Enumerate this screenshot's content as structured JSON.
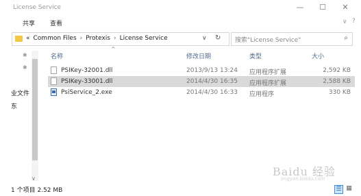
{
  "window": {
    "title": "License Service",
    "minimize": "—",
    "maximize": "☐",
    "close": "✕"
  },
  "ribbon": {
    "tabs": [
      "共享",
      "查看"
    ],
    "collapse_icon": "∨",
    "help_icon": "?"
  },
  "address": {
    "prefix": "«",
    "crumbs": [
      "Common Files",
      "Protexis",
      "License Service"
    ],
    "separator": "›",
    "dropdown": "∨",
    "refresh": "↻"
  },
  "search": {
    "placeholder": "搜索\"License Service\"",
    "icon": "⌕"
  },
  "nav": {
    "pins": [
      "✱",
      "✱"
    ],
    "items": [
      "业文件",
      "东"
    ],
    "arrow_down": "∨"
  },
  "columns": {
    "name": "名称",
    "modified": "修改日期",
    "type": "类型",
    "size": "大小",
    "sort_indicator": "^"
  },
  "files": [
    {
      "name": "PSIKey-32001.dll",
      "modified": "2013/9/13 13:24",
      "type": "应用程序扩展",
      "size": "2,592 KB",
      "selected": false,
      "kind": "dll"
    },
    {
      "name": "PSIKey-33001.dll",
      "modified": "2014/4/30 16:35",
      "type": "应用程序扩展",
      "size": "2,588 KB",
      "selected": true,
      "kind": "dll"
    },
    {
      "name": "PsiService_2.exe",
      "modified": "2014/4/30 16:33",
      "type": "应用程序",
      "size": "330 KB",
      "selected": false,
      "kind": "exe"
    }
  ],
  "status": {
    "text": "1 个项目  2.52 MB",
    "view_details": "☰",
    "view_icons": "▦"
  },
  "watermark": {
    "main": "Baidu 经验",
    "sub": "jingyan.baidu.com"
  }
}
